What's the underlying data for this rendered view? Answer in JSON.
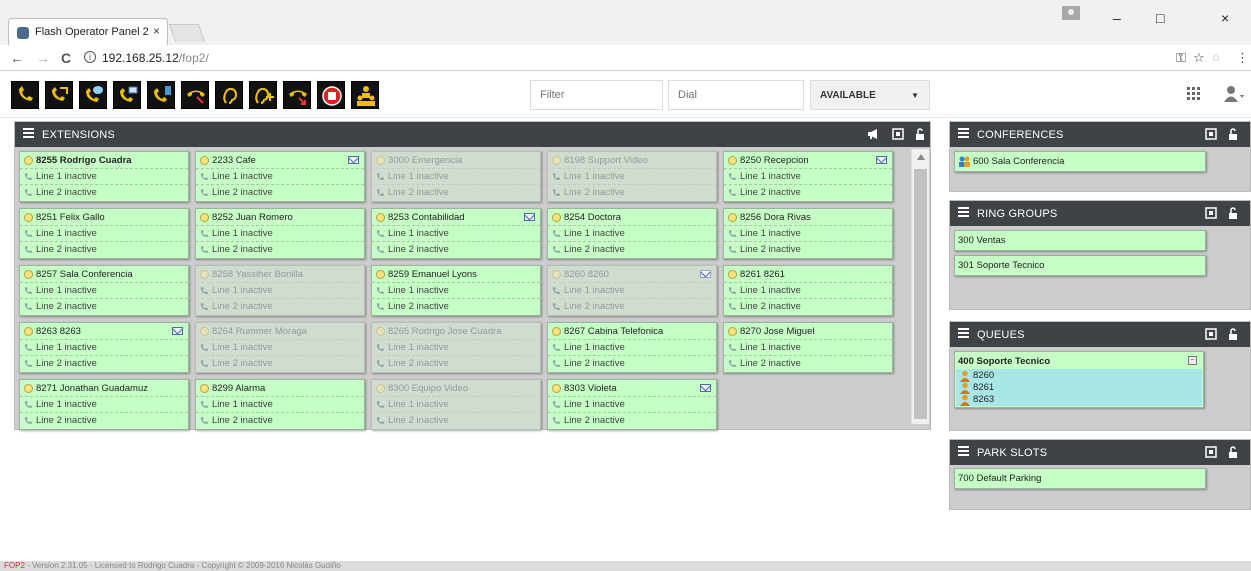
{
  "browser": {
    "tab_title": "Flash Operator Panel 2",
    "tab_close": "×",
    "url_host": "192.168.25.12",
    "url_path": "/fop2/",
    "window_min": "–",
    "window_max": "□",
    "window_close": "×",
    "back": "←",
    "forward": "→",
    "reload": "C",
    "info": "i",
    "star": "☆",
    "key": "⚿",
    "menu": "⋮"
  },
  "toolbar": {
    "buttons": [
      {
        "name": "dial-button",
        "icon": "phone-icon"
      },
      {
        "name": "transfer-button",
        "icon": "phone-arrow-icon"
      },
      {
        "name": "chat-transfer-button",
        "icon": "phone-chat-icon"
      },
      {
        "name": "voicemail-transfer-button",
        "icon": "phone-mail-icon"
      },
      {
        "name": "mobile-transfer-button",
        "icon": "phone-mobile-icon"
      },
      {
        "name": "hangup-button",
        "icon": "hangup-icon"
      },
      {
        "name": "listen-button",
        "icon": "ear-icon"
      },
      {
        "name": "whisper-button",
        "icon": "ear-plus-icon"
      },
      {
        "name": "pickup-button",
        "icon": "pickup-icon"
      },
      {
        "name": "record-button",
        "icon": "record-icon"
      },
      {
        "name": "conference-button",
        "icon": "group-icon"
      }
    ],
    "filter_placeholder": "Filter",
    "dial_placeholder": "Dial",
    "status_value": "AVAILABLE"
  },
  "extensions_panel": {
    "title": "EXTENSIONS",
    "tiles": [
      {
        "name": "8255 Rodrigo Cuadra",
        "active": true,
        "bold": true,
        "mail": false,
        "line1": "Line 1 inactive",
        "line2": "Line 2 inactive"
      },
      {
        "name": "2233 Cafe",
        "active": true,
        "bold": false,
        "mail": true,
        "line1": "Line 1 inactive",
        "line2": "Line 2 inactive"
      },
      {
        "name": "3000 Emergencia",
        "active": false,
        "bold": false,
        "mail": false,
        "line1": "Line 1 inactive",
        "line2": "Line 2 inactive"
      },
      {
        "name": "8198 Support Video",
        "active": false,
        "bold": false,
        "mail": false,
        "line1": "Line 1 inactive",
        "line2": "Line 2 inactive"
      },
      {
        "name": "8250 Recepcion",
        "active": true,
        "bold": false,
        "mail": true,
        "line1": "Line 1 inactive",
        "line2": "Line 2 inactive"
      },
      {
        "name": "8251 Felix Gallo",
        "active": true,
        "bold": false,
        "mail": false,
        "line1": "Line 1 inactive",
        "line2": "Line 2 inactive"
      },
      {
        "name": "8252 Juan Romero",
        "active": true,
        "bold": false,
        "mail": false,
        "line1": "Line 1 inactive",
        "line2": "Line 2 inactive"
      },
      {
        "name": "8253 Contabilidad",
        "active": true,
        "bold": false,
        "mail": true,
        "line1": "Line 1 inactive",
        "line2": "Line 2 inactive"
      },
      {
        "name": "8254 Doctora",
        "active": true,
        "bold": false,
        "mail": false,
        "line1": "Line 1 inactive",
        "line2": "Line 2 inactive"
      },
      {
        "name": "8256 Dora Rivas",
        "active": true,
        "bold": false,
        "mail": false,
        "line1": "Line 1 inactive",
        "line2": "Line 2 inactive"
      },
      {
        "name": "8257 Sala Conferencia",
        "active": true,
        "bold": false,
        "mail": false,
        "line1": "Line 1 inactive",
        "line2": "Line 2 inactive"
      },
      {
        "name": "8258 Yassiher Bonilla",
        "active": false,
        "bold": false,
        "mail": false,
        "line1": "Line 1 inactive",
        "line2": "Line 2 inactive"
      },
      {
        "name": "8259 Emanuel Lyons",
        "active": true,
        "bold": false,
        "mail": false,
        "line1": "Line 1 inactive",
        "line2": "Line 2 inactive"
      },
      {
        "name": "8260 8260",
        "active": false,
        "bold": false,
        "mail": true,
        "line1": "Line 1 inactive",
        "line2": "Line 2 inactive"
      },
      {
        "name": "8261 8261",
        "active": true,
        "bold": false,
        "mail": false,
        "line1": "Line 1 inactive",
        "line2": "Line 2 inactive"
      },
      {
        "name": "8263 8263",
        "active": true,
        "bold": false,
        "mail": true,
        "line1": "Line 1 inactive",
        "line2": "Line 2 inactive"
      },
      {
        "name": "8264 Rummer Moraga",
        "active": false,
        "bold": false,
        "mail": false,
        "line1": "Line 1 inactive",
        "line2": "Line 2 inactive"
      },
      {
        "name": "8265 Rodrigo Jose Cuadra",
        "active": false,
        "bold": false,
        "mail": false,
        "line1": "Line 1 inactive",
        "line2": "Line 2 inactive"
      },
      {
        "name": "8267 Cabina Telefonica",
        "active": true,
        "bold": false,
        "mail": false,
        "line1": "Line 1 inactive",
        "line2": "Line 2 inactive"
      },
      {
        "name": "8270 Jose Miguel",
        "active": true,
        "bold": false,
        "mail": false,
        "line1": "Line 1 inactive",
        "line2": "Line 2 inactive"
      },
      {
        "name": "8271 Jonathan Guadamuz",
        "active": true,
        "bold": false,
        "mail": false,
        "line1": "Line 1 inactive",
        "line2": "Line 2 inactive"
      },
      {
        "name": "8299 Alarma",
        "active": true,
        "bold": false,
        "mail": false,
        "line1": "Line 1 inactive",
        "line2": "Line 2 inactive"
      },
      {
        "name": "8300 Equipo Video",
        "active": false,
        "bold": false,
        "mail": false,
        "line1": "Line 1 inactive",
        "line2": "Line 2 inactive"
      },
      {
        "name": "8303 Violeta",
        "active": true,
        "bold": false,
        "mail": true,
        "line1": "Line 1 inactive",
        "line2": "Line 2 inactive"
      }
    ]
  },
  "conferences_panel": {
    "title": "CONFERENCES",
    "items": [
      "600 Sala Conferencia"
    ]
  },
  "ring_groups_panel": {
    "title": "RING GROUPS",
    "items": [
      "300 Ventas",
      "301 Soporte Tecnico"
    ]
  },
  "queues_panel": {
    "title": "QUEUES",
    "queue_name": "400 Soporte Tecnico",
    "toggle": "−",
    "members": [
      "8260",
      "8261",
      "8263"
    ]
  },
  "park_slots_panel": {
    "title": "PARK SLOTS",
    "items": [
      "700 Default Parking"
    ]
  },
  "footer": {
    "brand": "FOP2",
    "text": " - Version 2.31.05 - Licensed to Rodrigo Cuadra - Copyright © 2009-2016 Nicolás Gudiño"
  },
  "colors": {
    "tile_active": "#c6ffc6",
    "tile_inactive": "#cfdccf",
    "panel_header": "#3f4247",
    "queue_members": "#a9e6e6"
  }
}
